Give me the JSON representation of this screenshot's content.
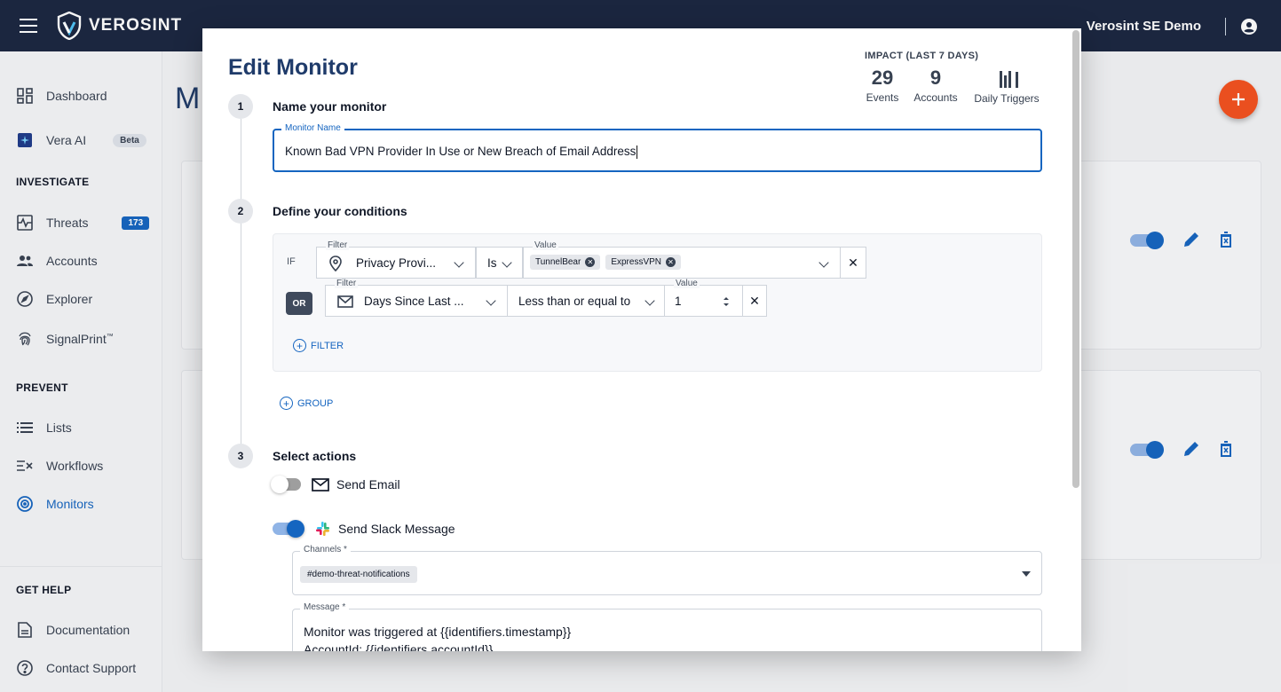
{
  "header": {
    "brand": "VEROSINT",
    "org_name": "Verosint SE Demo"
  },
  "sidebar": {
    "dashboard": "Dashboard",
    "vera_ai": "Vera AI",
    "vera_badge": "Beta",
    "investigate_title": "INVESTIGATE",
    "threats": "Threats",
    "threats_count": "173",
    "accounts": "Accounts",
    "explorer": "Explorer",
    "signalprint": "SignalPrint",
    "signalprint_tm": "™",
    "prevent_title": "PREVENT",
    "lists": "Lists",
    "workflows": "Workflows",
    "monitors": "Monitors",
    "gethelp_title": "GET HELP",
    "documentation": "Documentation",
    "contact_support": "Contact Support"
  },
  "background": {
    "page_title_partial": "M"
  },
  "modal": {
    "title": "Edit Monitor",
    "impact": {
      "title": "IMPACT (LAST 7 DAYS)",
      "events_value": "29",
      "events_label": "Events",
      "accounts_value": "9",
      "accounts_label": "Accounts",
      "triggers_label": "Daily Triggers"
    },
    "steps": {
      "s1_num": "1",
      "s1_label": "Name your monitor",
      "s2_num": "2",
      "s2_label": "Define your conditions",
      "s3_num": "3",
      "s3_label": "Select actions"
    },
    "name_field": {
      "label": "Monitor Name",
      "value": "Known Bad VPN Provider In Use or New Breach of Email Address"
    },
    "conditions": {
      "if_label": "IF",
      "or_label": "OR",
      "row1": {
        "filter_label": "Filter",
        "filter_value": "Privacy Provi...",
        "operator": "Is",
        "value_label": "Value",
        "chips": [
          "TunnelBear",
          "ExpressVPN"
        ]
      },
      "row2": {
        "filter_label": "Filter",
        "filter_value": "Days Since Last ...",
        "operator": "Less than or equal to",
        "value_label": "Value",
        "value": "1"
      },
      "add_filter": "FILTER",
      "add_group": "GROUP"
    },
    "actions": {
      "send_email": "Send Email",
      "send_email_enabled": false,
      "send_slack": "Send Slack Message",
      "send_slack_enabled": true,
      "channels_label": "Channels *",
      "channel_chip": "#demo-threat-notifications",
      "message_label": "Message *",
      "message_line1": "Monitor was triggered at {{identifiers.timestamp}}",
      "message_line2": "AccountId: {{identifiers.accountId}}"
    }
  },
  "colors": {
    "topbar": "#1a2540",
    "accent": "#1565c0",
    "fab": "#f4511e",
    "title": "#1f3b6a"
  }
}
